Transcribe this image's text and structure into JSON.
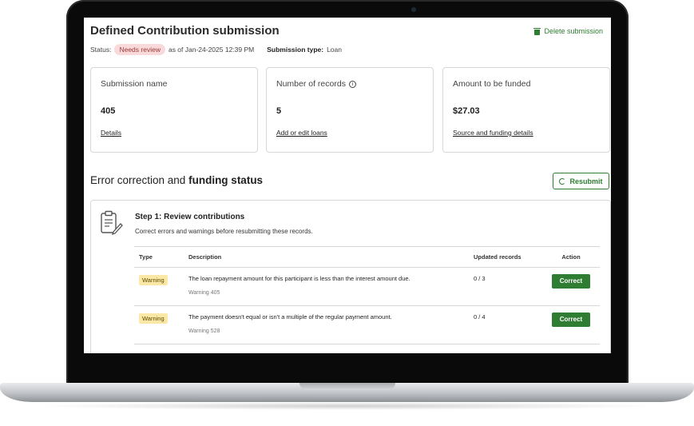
{
  "header": {
    "title": "Defined Contribution submission",
    "delete_label": "Delete submission"
  },
  "status": {
    "label": "Status:",
    "badge": "Needs review",
    "as_of": "as of Jan-24-2025 12:39 PM",
    "type_label": "Submission type:",
    "type_value": "Loan"
  },
  "cards": [
    {
      "label": "Submission name",
      "value": "405",
      "link": "Details"
    },
    {
      "label": "Number of records",
      "value": "5",
      "link": "Add or edit loans"
    },
    {
      "label": "Amount to be funded",
      "value": "$27.03",
      "link": "Source and funding details"
    }
  ],
  "section": {
    "title_prefix": "Error correction and",
    "title_bold": "funding status",
    "resubmit_label": "Resubmit"
  },
  "step": {
    "title": "Step 1: Review contributions",
    "description": "Correct errors and warnings before resubmitting these records."
  },
  "table": {
    "headers": [
      "Type",
      "Description",
      "Updated records",
      "Action"
    ],
    "rows": [
      {
        "type": "Warning",
        "description": "The loan repayment amount for this participant is less than the interest amount due.",
        "code": "Warning 405",
        "updated": "0 / 3",
        "action": "Correct"
      },
      {
        "type": "Warning",
        "description": "The payment doesn't equal or isn't a multiple of the regular payment amount.",
        "code": "Warning 528",
        "updated": "0 / 4",
        "action": "Correct"
      }
    ]
  },
  "colors": {
    "accent_green": "#2e7d32",
    "review_badge_bg": "#f9d9d9",
    "warning_badge_bg": "#fbe8a6"
  }
}
